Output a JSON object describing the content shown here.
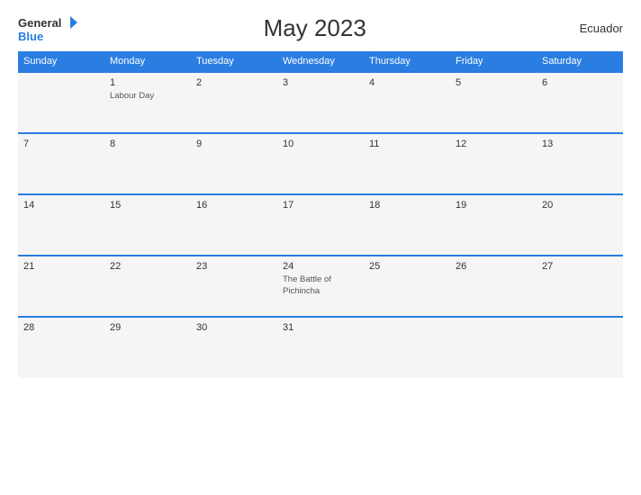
{
  "header": {
    "logo_general": "General",
    "logo_blue": "Blue",
    "title": "May 2023",
    "country": "Ecuador"
  },
  "calendar": {
    "days_of_week": [
      "Sunday",
      "Monday",
      "Tuesday",
      "Wednesday",
      "Thursday",
      "Friday",
      "Saturday"
    ],
    "weeks": [
      [
        {
          "num": "",
          "event": ""
        },
        {
          "num": "1",
          "event": "Labour Day"
        },
        {
          "num": "2",
          "event": ""
        },
        {
          "num": "3",
          "event": ""
        },
        {
          "num": "4",
          "event": ""
        },
        {
          "num": "5",
          "event": ""
        },
        {
          "num": "6",
          "event": ""
        }
      ],
      [
        {
          "num": "7",
          "event": ""
        },
        {
          "num": "8",
          "event": ""
        },
        {
          "num": "9",
          "event": ""
        },
        {
          "num": "10",
          "event": ""
        },
        {
          "num": "11",
          "event": ""
        },
        {
          "num": "12",
          "event": ""
        },
        {
          "num": "13",
          "event": ""
        }
      ],
      [
        {
          "num": "14",
          "event": ""
        },
        {
          "num": "15",
          "event": ""
        },
        {
          "num": "16",
          "event": ""
        },
        {
          "num": "17",
          "event": ""
        },
        {
          "num": "18",
          "event": ""
        },
        {
          "num": "19",
          "event": ""
        },
        {
          "num": "20",
          "event": ""
        }
      ],
      [
        {
          "num": "21",
          "event": ""
        },
        {
          "num": "22",
          "event": ""
        },
        {
          "num": "23",
          "event": ""
        },
        {
          "num": "24",
          "event": "The Battle of Pichincha"
        },
        {
          "num": "25",
          "event": ""
        },
        {
          "num": "26",
          "event": ""
        },
        {
          "num": "27",
          "event": ""
        }
      ],
      [
        {
          "num": "28",
          "event": ""
        },
        {
          "num": "29",
          "event": ""
        },
        {
          "num": "30",
          "event": ""
        },
        {
          "num": "31",
          "event": ""
        },
        {
          "num": "",
          "event": ""
        },
        {
          "num": "",
          "event": ""
        },
        {
          "num": "",
          "event": ""
        }
      ]
    ]
  }
}
